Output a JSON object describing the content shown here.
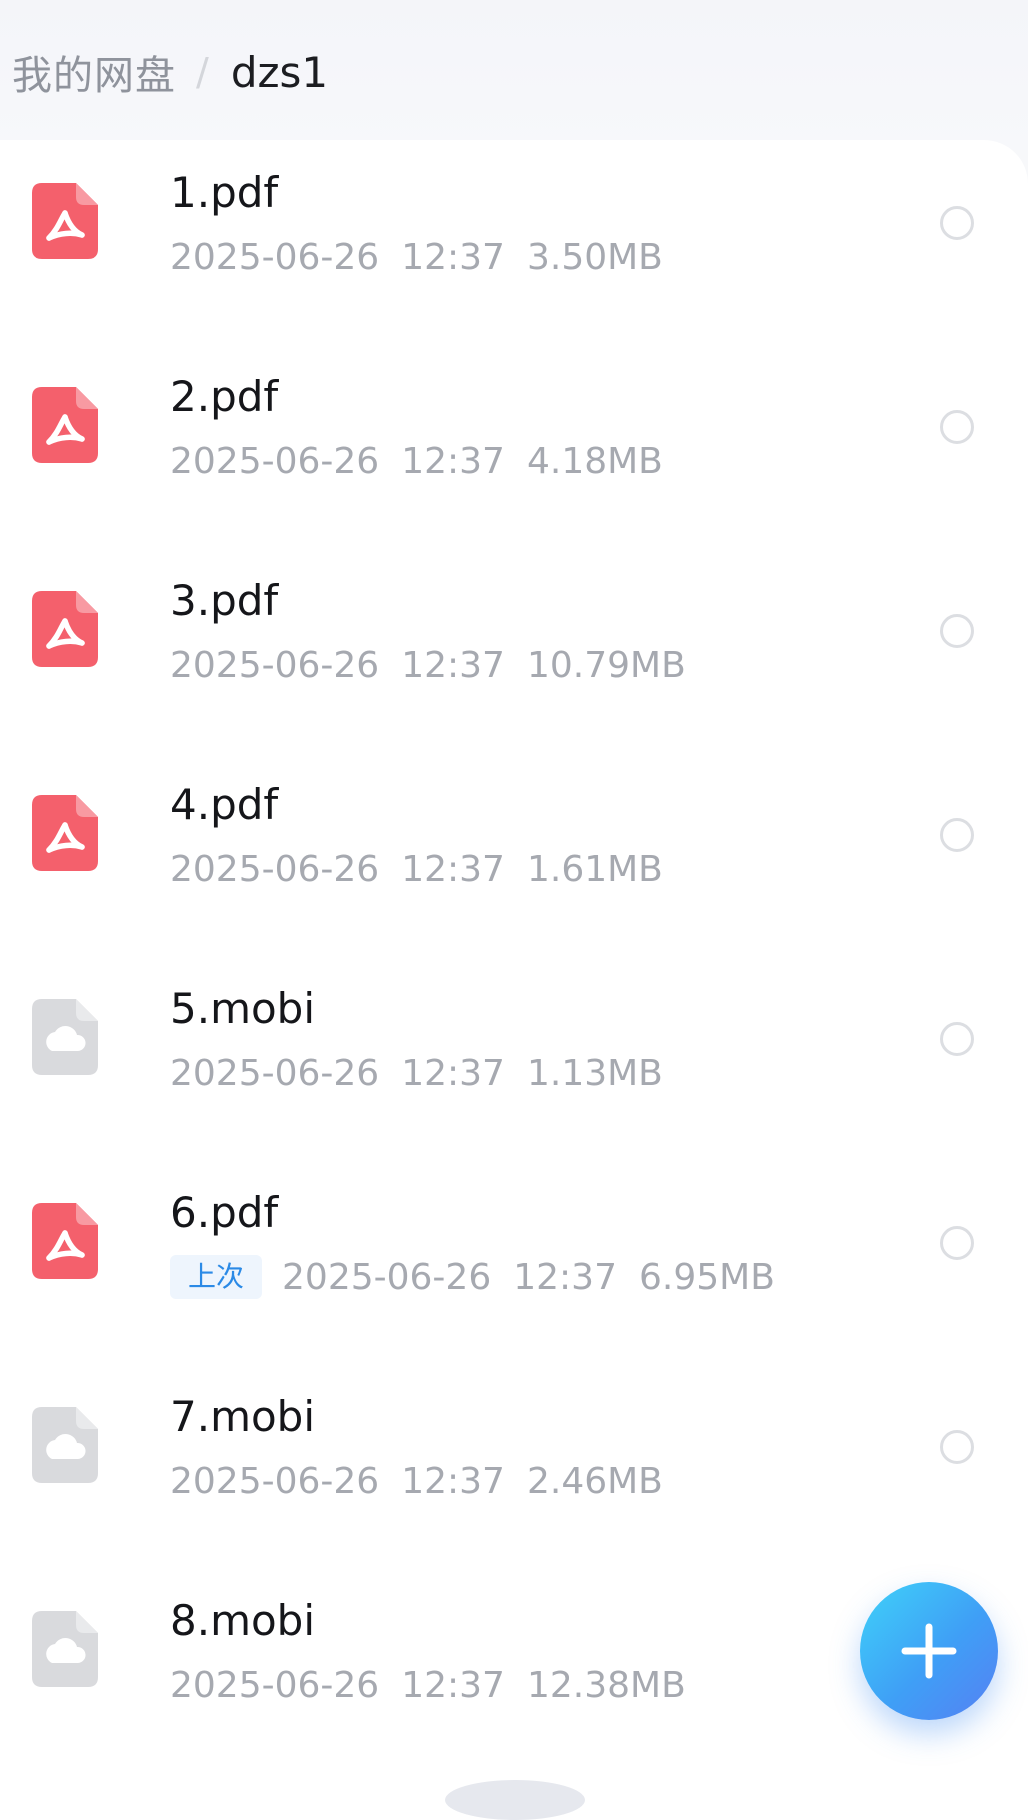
{
  "breadcrumb": {
    "root": "我的网盘",
    "separator": "/",
    "current": "dzs1"
  },
  "files": [
    {
      "name": "1.pdf",
      "date": "2025-06-26",
      "time": "12:37",
      "size": "3.50MB",
      "type": "pdf",
      "icon": "pdf-file-icon",
      "tag": ""
    },
    {
      "name": "2.pdf",
      "date": "2025-06-26",
      "time": "12:37",
      "size": "4.18MB",
      "type": "pdf",
      "icon": "pdf-file-icon",
      "tag": ""
    },
    {
      "name": "3.pdf",
      "date": "2025-06-26",
      "time": "12:37",
      "size": "10.79MB",
      "type": "pdf",
      "icon": "pdf-file-icon",
      "tag": ""
    },
    {
      "name": "4.pdf",
      "date": "2025-06-26",
      "time": "12:37",
      "size": "1.61MB",
      "type": "pdf",
      "icon": "pdf-file-icon",
      "tag": ""
    },
    {
      "name": "5.mobi",
      "date": "2025-06-26",
      "time": "12:37",
      "size": "1.13MB",
      "type": "mobi",
      "icon": "cloud-file-icon",
      "tag": ""
    },
    {
      "name": "6.pdf",
      "date": "2025-06-26",
      "time": "12:37",
      "size": "6.95MB",
      "type": "pdf",
      "icon": "pdf-file-icon",
      "tag": "上次"
    },
    {
      "name": "7.mobi",
      "date": "2025-06-26",
      "time": "12:37",
      "size": "2.46MB",
      "type": "mobi",
      "icon": "cloud-file-icon",
      "tag": ""
    },
    {
      "name": "8.mobi",
      "date": "2025-06-26",
      "time": "12:37",
      "size": "12.38MB",
      "type": "mobi",
      "icon": "cloud-file-icon",
      "tag": ""
    }
  ],
  "fab": {
    "icon": "plus-icon"
  },
  "colors": {
    "pdf_icon": "#f4606c",
    "cloud_icon": "#d9dadd",
    "accent": "#3f9ff6",
    "recent_tag_text": "#2b8ae6"
  }
}
